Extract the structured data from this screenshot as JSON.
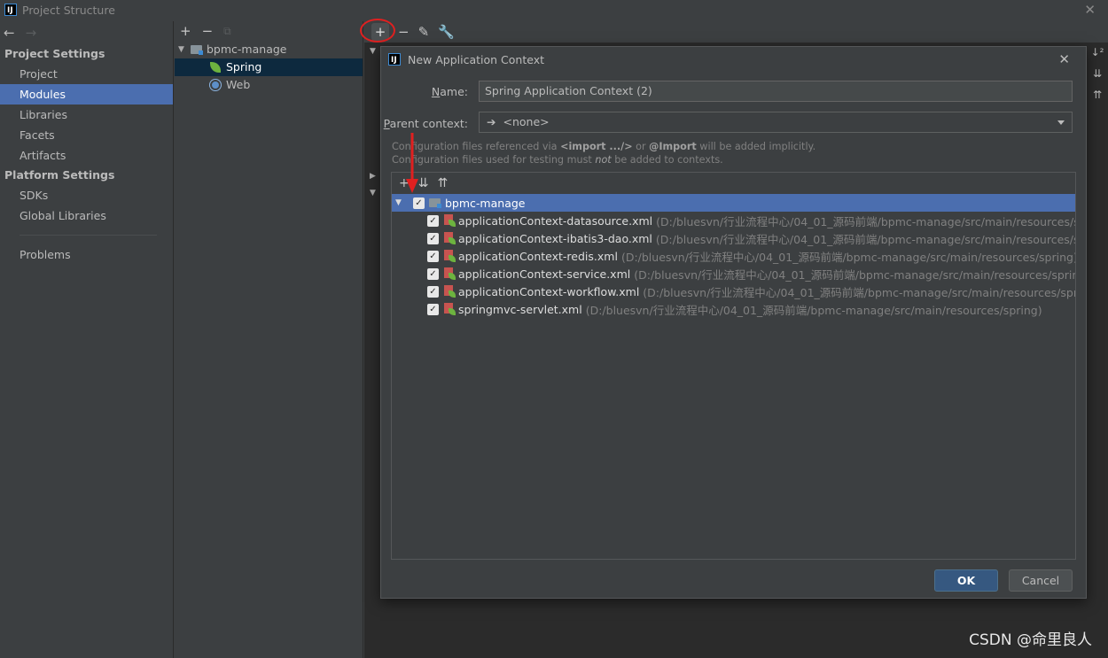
{
  "window": {
    "title": "Project Structure",
    "app_icon": "IJ"
  },
  "sidebar": {
    "project_settings_header": "Project Settings",
    "project_settings_items": [
      {
        "label": "Project"
      },
      {
        "label": "Modules"
      },
      {
        "label": "Libraries"
      },
      {
        "label": "Facets"
      },
      {
        "label": "Artifacts"
      }
    ],
    "platform_settings_header": "Platform Settings",
    "platform_settings_items": [
      {
        "label": "SDKs"
      },
      {
        "label": "Global Libraries"
      }
    ],
    "problems_label": "Problems",
    "selected": "Modules"
  },
  "module_tree": {
    "root": "bpmc-manage",
    "children": [
      {
        "label": "Spring"
      },
      {
        "label": "Web"
      }
    ]
  },
  "dialog": {
    "title": "New Application Context",
    "name_label_prefix": "N",
    "name_label_rest": "ame:",
    "name_value": "Spring Application Context (2)",
    "parent_label_prefix": "P",
    "parent_label_rest": "arent context:",
    "parent_value": "<none>",
    "hint_line1": {
      "a": "Configuration files referenced via ",
      "b": "<import .../>",
      "c": " or ",
      "d": "@Import",
      "e": " will be added implicitly."
    },
    "hint_line2": {
      "a": "Configuration files used for testing must ",
      "b": "not",
      "c": " be added to contexts."
    },
    "tree_root": "bpmc-manage",
    "files": [
      {
        "name": "applicationContext-datasource.xml",
        "path": "(D:/bluesvn/行业流程中心/04_01_源码前端/bpmc-manage/src/main/resources/spring)"
      },
      {
        "name": "applicationContext-ibatis3-dao.xml",
        "path": "(D:/bluesvn/行业流程中心/04_01_源码前端/bpmc-manage/src/main/resources/spring)"
      },
      {
        "name": "applicationContext-redis.xml",
        "path": "(D:/bluesvn/行业流程中心/04_01_源码前端/bpmc-manage/src/main/resources/spring)"
      },
      {
        "name": "applicationContext-service.xml",
        "path": "(D:/bluesvn/行业流程中心/04_01_源码前端/bpmc-manage/src/main/resources/spring)"
      },
      {
        "name": "applicationContext-workflow.xml",
        "path": "(D:/bluesvn/行业流程中心/04_01_源码前端/bpmc-manage/src/main/resources/spring)"
      },
      {
        "name": "springmvc-servlet.xml",
        "path": "(D:/bluesvn/行业流程中心/04_01_源码前端/bpmc-manage/src/main/resources/spring)"
      }
    ],
    "ok_label": "OK",
    "cancel_label": "Cancel"
  },
  "watermark": "CSDN @命里良人",
  "colors": {
    "selection": "#4b6eaf",
    "annotation": "#e02020",
    "background": "#3c3f41"
  }
}
